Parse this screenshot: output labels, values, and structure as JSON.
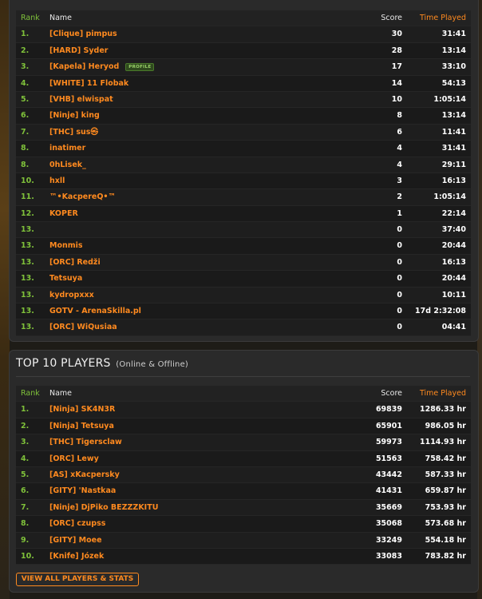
{
  "current_server": {
    "headers": {
      "rank": "Rank",
      "name": "Name",
      "score": "Score",
      "time": "Time Played"
    },
    "rows": [
      {
        "rank": "1.",
        "name": "[Clique] pimpus",
        "score": "30",
        "time": "31:41"
      },
      {
        "rank": "2.",
        "name": "[HARD] Syder",
        "score": "28",
        "time": "13:14"
      },
      {
        "rank": "3.",
        "name": "[Kapela] Heryod",
        "badge": "PROFILE",
        "score": "17",
        "time": "33:10"
      },
      {
        "rank": "4.",
        "name": "[WHITE] 11 Flobak",
        "score": "14",
        "time": "54:13"
      },
      {
        "rank": "5.",
        "name": "[VHB] elwispat",
        "score": "10",
        "time": "1:05:14"
      },
      {
        "rank": "6.",
        "name": "[Ninje] king",
        "score": "8",
        "time": "13:14"
      },
      {
        "rank": "7.",
        "name": "[THC] sus㉿",
        "score": "6",
        "time": "11:41"
      },
      {
        "rank": "8.",
        "name": "inatimer",
        "score": "4",
        "time": "31:41"
      },
      {
        "rank": "8.",
        "name": "0hLisek_",
        "score": "4",
        "time": "29:11"
      },
      {
        "rank": "10.",
        "name": "hxll",
        "score": "3",
        "time": "16:13"
      },
      {
        "rank": "11.",
        "name": "™•KacpereQ•™",
        "score": "2",
        "time": "1:05:14"
      },
      {
        "rank": "12.",
        "name": "KOPER",
        "score": "1",
        "time": "22:14"
      },
      {
        "rank": "13.",
        "name": "",
        "score": "0",
        "time": "37:40"
      },
      {
        "rank": "13.",
        "name": "Monmis",
        "score": "0",
        "time": "20:44"
      },
      {
        "rank": "13.",
        "name": "[ORC] Redži",
        "score": "0",
        "time": "16:13"
      },
      {
        "rank": "13.",
        "name": "Tetsuya",
        "score": "0",
        "time": "20:44"
      },
      {
        "rank": "13.",
        "name": "kydropxxx",
        "score": "0",
        "time": "10:11"
      },
      {
        "rank": "13.",
        "name": "GOTV - ArenaSkilla.pl",
        "score": "0",
        "time": "17d 2:32:08"
      },
      {
        "rank": "13.",
        "name": "[ORC] WiQusiaa",
        "score": "0",
        "time": "04:41"
      }
    ]
  },
  "top_players": {
    "title": "TOP 10 PLAYERS",
    "subtitle": "(Online & Offline)",
    "headers": {
      "rank": "Rank",
      "name": "Name",
      "score": "Score",
      "time": "Time Played"
    },
    "rows": [
      {
        "rank": "1.",
        "name": "[Ninja] SK4N3R",
        "score": "69839",
        "time": "1286.33 hr"
      },
      {
        "rank": "2.",
        "name": "[Ninja] Tetsuya",
        "score": "65901",
        "time": "986.05 hr"
      },
      {
        "rank": "3.",
        "name": "[THC] Tigersclaw",
        "score": "59973",
        "time": "1114.93 hr"
      },
      {
        "rank": "4.",
        "name": "[ORC] Lewy",
        "score": "51563",
        "time": "758.42 hr"
      },
      {
        "rank": "5.",
        "name": "[AS] xKacpersky",
        "score": "43442",
        "time": "587.33 hr"
      },
      {
        "rank": "6.",
        "name": "[GITY] 'Nastkaa",
        "score": "41431",
        "time": "659.87 hr"
      },
      {
        "rank": "7.",
        "name": "[Ninje] DjPiko BEZZZKITU",
        "score": "35669",
        "time": "753.93 hr"
      },
      {
        "rank": "8.",
        "name": "[ORC] czupss",
        "score": "35068",
        "time": "573.68 hr"
      },
      {
        "rank": "9.",
        "name": "[GITY] Moee",
        "score": "33249",
        "time": "554.18 hr"
      },
      {
        "rank": "10.",
        "name": "[Knife] Józek",
        "score": "33083",
        "time": "783.82 hr"
      }
    ],
    "view_all_label": "VIEW ALL PLAYERS & STATS"
  }
}
